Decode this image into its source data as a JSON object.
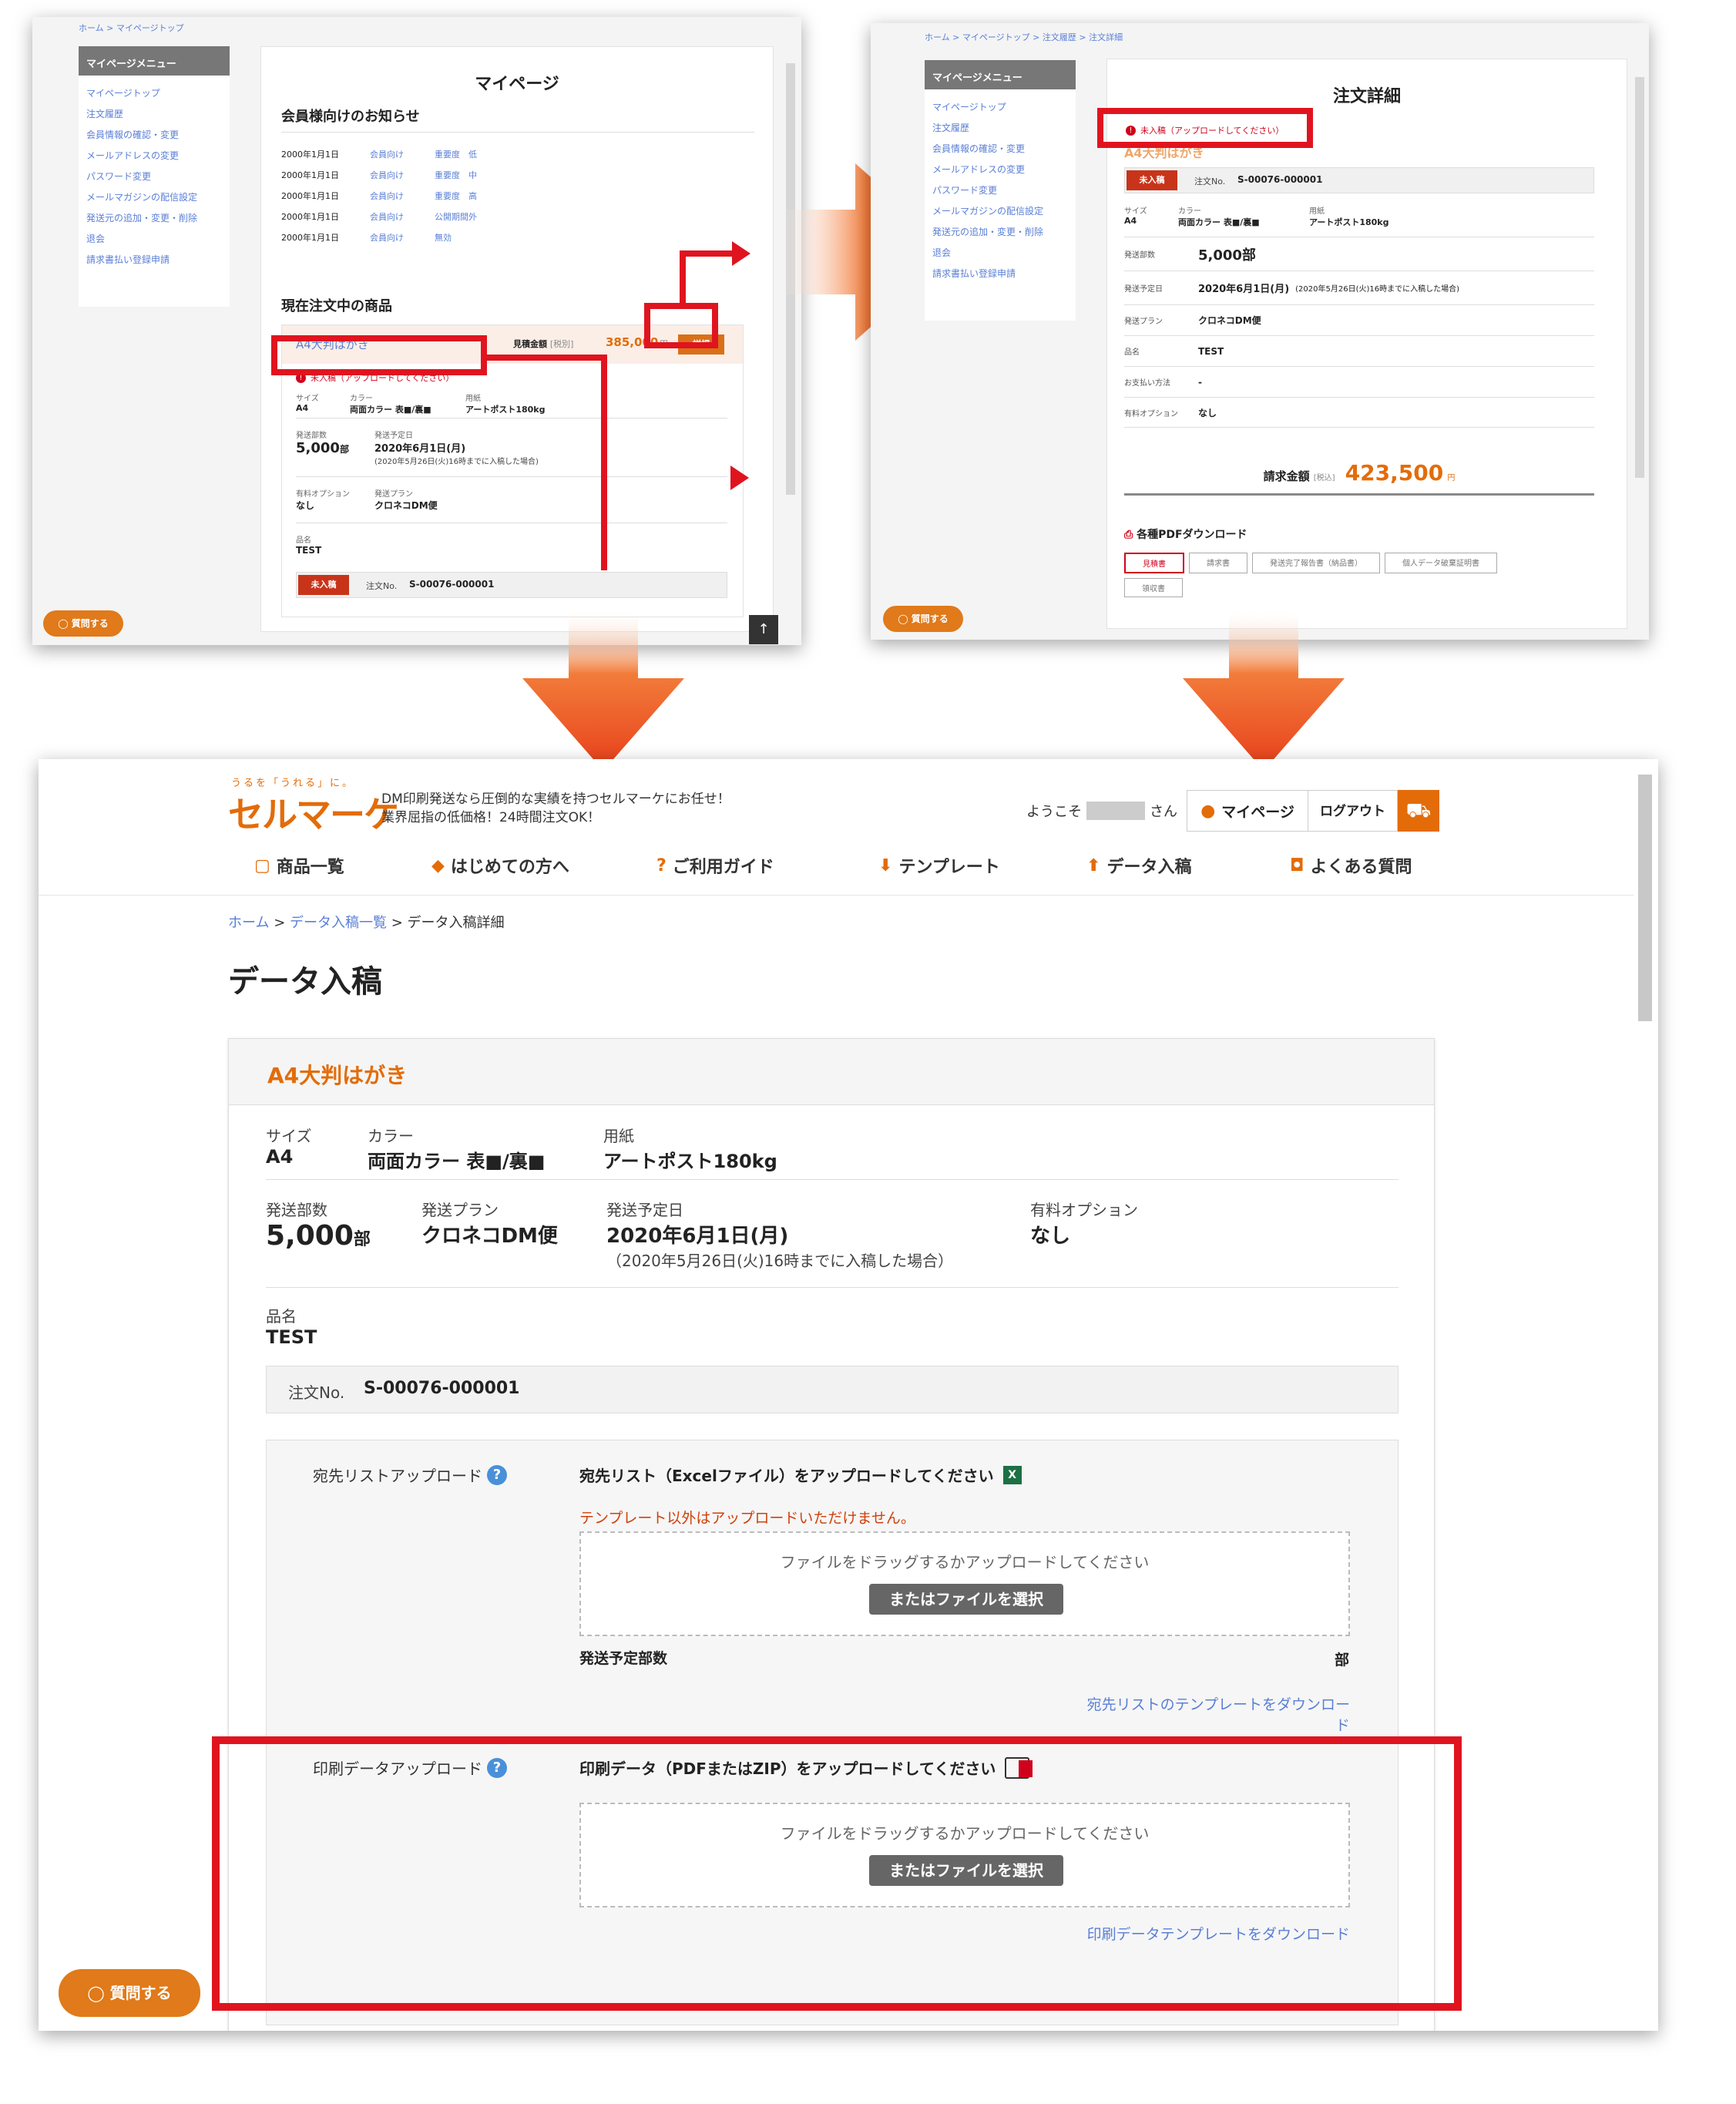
{
  "s1": {
    "breadcrumb": "ホーム > マイページトップ",
    "menu_title": "マイページメニュー",
    "menu": [
      "マイページトップ",
      "注文履歴",
      "会員情報の確認・変更",
      "メールアドレスの変更",
      "パスワード変更",
      "メールマガジンの配信設定",
      "発送元の追加・変更・削除",
      "退会",
      "請求書払い登録申請"
    ],
    "title": "マイページ",
    "notice_title": "会員様向けのお知らせ",
    "notices": [
      {
        "date": "2000年1月1日",
        "a": "会員向け",
        "b": "重要度　低"
      },
      {
        "date": "2000年1月1日",
        "a": "会員向け",
        "b": "重要度　中"
      },
      {
        "date": "2000年1月1日",
        "a": "会員向け",
        "b": "重要度　高"
      },
      {
        "date": "2000年1月1日",
        "a": "会員向け",
        "b": "公開期間外"
      },
      {
        "date": "2000年1月1日",
        "a": "会員向け",
        "b": "無効"
      }
    ],
    "current_title": "現在注文中の商品",
    "product": "A4大判はがき",
    "est_label": "見積金額",
    "est_tax": "[税別]",
    "est_value": "385,000",
    "yen": "円",
    "detail_btn": "詳細",
    "warn": "未入稿（アップロードしてください）",
    "size_l": "サイズ",
    "size_v": "A4",
    "color_l": "カラー",
    "color_v": "両面カラー 表■/裏■",
    "paper_l": "用紙",
    "paper_v": "アートポスト180kg",
    "qty_l": "発送部数",
    "qty_v": "5,000",
    "qty_u": "部",
    "date_l": "発送予定日",
    "date_v": "2020年6月1日(月)",
    "date_note": "(2020年5月26日(火)16時までに入稿した場合)",
    "opt_l": "有料オプション",
    "opt_v": "なし",
    "plan_l": "発送プラン",
    "plan_v": "クロネコDM便",
    "name_l": "品名",
    "name_v": "TEST",
    "status": "未入稿",
    "order_l": "注文No.",
    "order_v": "S-00076-000001",
    "ask": "質問する",
    "top": "↑"
  },
  "s2": {
    "breadcrumb": "ホーム > マイページトップ > 注文履歴 > 注文詳細",
    "menu_title": "マイページメニュー",
    "menu": [
      "マイページトップ",
      "注文履歴",
      "会員情報の確認・変更",
      "メールアドレスの変更",
      "パスワード変更",
      "メールマガジンの配信設定",
      "発送元の追加・変更・削除",
      "退会",
      "請求書払い登録申請"
    ],
    "title": "注文詳細",
    "warn": "未入稿（アップロードしてください）",
    "product": "A4大判はがき",
    "status": "未入稿",
    "order_l": "注文No.",
    "order_v": "S-00076-000001",
    "size_l": "サイズ",
    "size_v": "A4",
    "color_l": "カラー",
    "color_v": "両面カラー 表■/裏■",
    "paper_l": "用紙",
    "paper_v": "アートポスト180kg",
    "rows": [
      {
        "l": "発送部数",
        "v": "5,000部"
      },
      {
        "l": "発送予定日",
        "v": "2020年6月1日(月)",
        "n": "(2020年5月26日(火)16時までに入稿した場合)"
      },
      {
        "l": "発送プラン",
        "v": "クロネコDM便"
      },
      {
        "l": "品名",
        "v": "TEST"
      },
      {
        "l": "お支払い方法",
        "v": "-"
      },
      {
        "l": "有料オプション",
        "v": "なし"
      }
    ],
    "bill_l": "請求金額",
    "bill_tax": "[税込]",
    "bill_v": "423,500",
    "yen": "円",
    "pdf_title": "各種PDFダウンロード",
    "pdf_btns": [
      "見積書",
      "請求書",
      "発送完了報告書（納品書）",
      "個人データ破棄証明書",
      "領収書"
    ],
    "ask": "質問する"
  },
  "s3": {
    "logo_small": "うるを「うれる」に。",
    "logo": "セルマーケ",
    "tagline1": "DM印刷発送なら圧倒的な実績を持つセルマーケにお任せ！",
    "tagline2": "業界屈指の低価格！24時間注文OK！",
    "welcome": "ようこそ",
    "san": "さん",
    "mypage": "マイページ",
    "logout": "ログアウト",
    "nav": [
      "商品一覧",
      "はじめての方へ",
      "ご利用ガイド",
      "テンプレート",
      "データ入稿",
      "よくある質問"
    ],
    "breadcrumb": [
      "ホーム",
      "データ入稿一覧",
      "データ入稿詳細"
    ],
    "title": "データ入稿",
    "product": "A4大判はがき",
    "size_l": "サイズ",
    "size_v": "A4",
    "color_l": "カラー",
    "color_v": "両面カラー 表■/裏■",
    "paper_l": "用紙",
    "paper_v": "アートポスト180kg",
    "qty_l": "発送部数",
    "qty_v": "5,000",
    "qty_u": "部",
    "plan_l": "発送プラン",
    "plan_v": "クロネコDM便",
    "date_l": "発送予定日",
    "date_v": "2020年6月1日(月)",
    "date_note": "（2020年5月26日(火)16時までに入稿した場合）",
    "opt_l": "有料オプション",
    "opt_v": "なし",
    "name_l": "品名",
    "name_v": "TEST",
    "order_l": "注文No.",
    "order_v": "S-00076-000001",
    "list_upload_l": "宛先リストアップロード",
    "list_upload_t": "宛先リスト（Excelファイル）をアップロードしてください",
    "list_warn": "テンプレート以外はアップロードいただけません。",
    "drop_text": "ファイルをドラッグするかアップロードしてください",
    "select_btn": "またはファイルを選択",
    "send_qty_l": "発送予定部数",
    "send_qty_u": "部",
    "list_tpl": "宛先リストのテンプレートをダウンロード",
    "print_upload_l": "印刷データアップロード",
    "print_upload_t": "印刷データ（PDFまたはZIP）をアップロードしてください",
    "print_tpl": "印刷データテンプレートをダウンロード",
    "ask": "質問する"
  },
  "colors": {
    "accent": "#e36c09",
    "highlight": "#e0141f",
    "link": "#5a7fd6"
  }
}
